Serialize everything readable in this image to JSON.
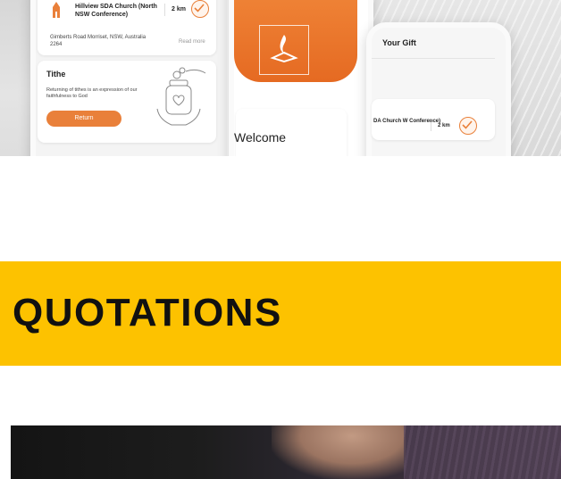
{
  "hero": {
    "church_name": "Hillview SDA Church (North NSW Conference)",
    "distance": "2 km",
    "address": "Gimberts Road Morriset, NSW, Australia 2264",
    "read_more": "Read more",
    "tithe_title": "Tithe",
    "tithe_desc": "Returning of tithes is an expression of our faithfulness to God",
    "return_label": "Return",
    "welcome": "Welcome",
    "gift_title": "Your Gift",
    "gift_church": "DA Church W Conference)",
    "gift_distance": "2 km"
  },
  "section": {
    "title": "QUOTATIONS"
  },
  "colors": {
    "accent_orange": "#e9803a",
    "band_yellow": "#fdc200"
  }
}
